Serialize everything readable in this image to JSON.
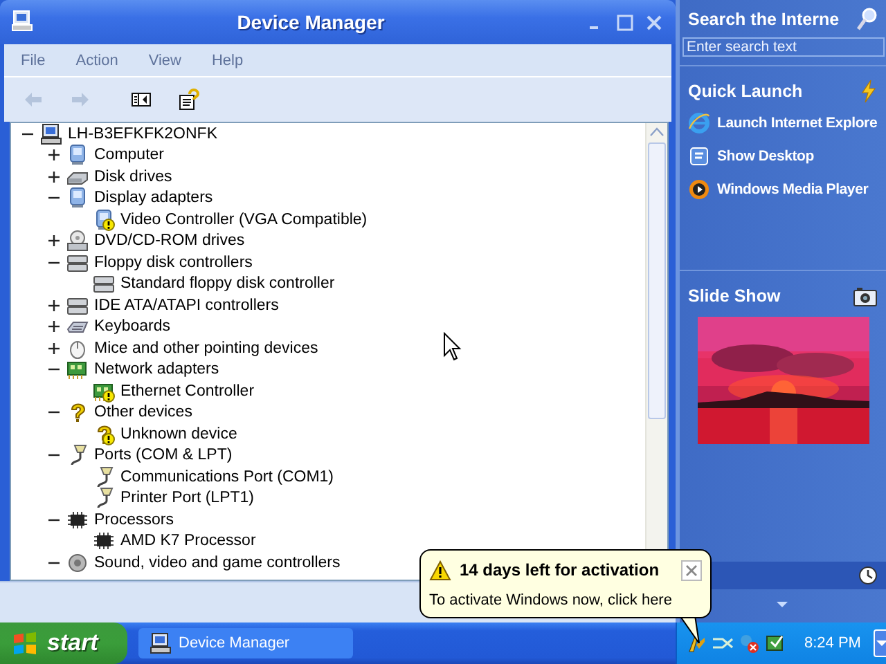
{
  "window": {
    "title": "Device Manager",
    "menu": [
      "File",
      "Action",
      "View",
      "Help"
    ],
    "toolbar": [
      {
        "kind": "back",
        "disabled": true
      },
      {
        "kind": "forward",
        "disabled": true
      },
      {
        "kind": "tree-pane",
        "disabled": false
      },
      {
        "kind": "properties",
        "disabled": false
      }
    ],
    "tree": {
      "label": "LH-B3EFKFK2ONFK",
      "kind": "computer",
      "expanded": true,
      "children": [
        {
          "label": "Computer",
          "kind": "pc",
          "expanded": false
        },
        {
          "label": "Disk drives",
          "kind": "disk",
          "expanded": false
        },
        {
          "label": "Display adapters",
          "kind": "pc",
          "expanded": true,
          "children": [
            {
              "label": "Video Controller (VGA Compatible)",
              "kind": "pc",
              "warning": true
            }
          ]
        },
        {
          "label": "DVD/CD-ROM drives",
          "kind": "dvd",
          "expanded": false
        },
        {
          "label": "Floppy disk controllers",
          "kind": "floppy",
          "expanded": true,
          "children": [
            {
              "label": "Standard floppy disk controller",
              "kind": "floppy",
              "warning": false
            }
          ]
        },
        {
          "label": "IDE ATA/ATAPI controllers",
          "kind": "floppy",
          "expanded": false
        },
        {
          "label": "Keyboards",
          "kind": "keyboard",
          "expanded": false
        },
        {
          "label": "Mice and other pointing devices",
          "kind": "mouse",
          "expanded": false
        },
        {
          "label": "Network adapters",
          "kind": "network",
          "expanded": true,
          "children": [
            {
              "label": "Ethernet Controller",
              "kind": "network",
              "warning": true
            }
          ]
        },
        {
          "label": "Other devices",
          "kind": "unknown",
          "expanded": true,
          "children": [
            {
              "label": "Unknown device",
              "kind": "unknown",
              "warning": true
            }
          ]
        },
        {
          "label": "Ports (COM & LPT)",
          "kind": "port",
          "expanded": true,
          "children": [
            {
              "label": "Communications Port (COM1)",
              "kind": "port",
              "warning": false
            },
            {
              "label": "Printer Port (LPT1)",
              "kind": "port",
              "warning": false
            }
          ]
        },
        {
          "label": "Processors",
          "kind": "chip",
          "expanded": true,
          "children": [
            {
              "label": "AMD K7 Processor",
              "kind": "chip",
              "warning": false
            }
          ]
        },
        {
          "label": "Sound, video and game controllers",
          "kind": "sound",
          "expanded": true
        }
      ]
    }
  },
  "sidebar": {
    "search": {
      "title": "Search the Interne",
      "placeholder": "Enter search text"
    },
    "quick_launch": {
      "title": "Quick Launch",
      "items": [
        {
          "label": "Launch Internet Explore",
          "kind": "browser"
        },
        {
          "label": "Show Desktop",
          "kind": "desktop"
        },
        {
          "label": "Windows Media Player",
          "kind": "media"
        }
      ]
    },
    "slide_show": {
      "title": "Slide Show",
      "kind": "picture"
    }
  },
  "balloon": {
    "title": "14 days left for activation",
    "text": "To activate Windows now, click here"
  },
  "taskbar": {
    "start": "start",
    "tasks": [
      {
        "label": "Device Manager",
        "selected": false
      }
    ],
    "clock": "8:24 PM"
  }
}
